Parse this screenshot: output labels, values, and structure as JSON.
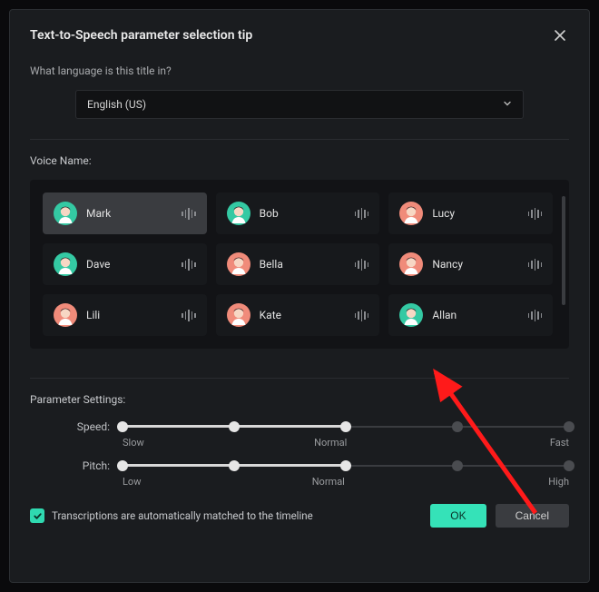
{
  "header": {
    "title": "Text-to-Speech parameter selection tip"
  },
  "language": {
    "prompt": "What language is this title in?",
    "selected": "English (US)"
  },
  "voiceSection": {
    "label": "Voice Name:",
    "voices": [
      {
        "name": "Mark",
        "gender": "m",
        "selected": true
      },
      {
        "name": "Bob",
        "gender": "m",
        "selected": false
      },
      {
        "name": "Lucy",
        "gender": "f",
        "selected": false
      },
      {
        "name": "Dave",
        "gender": "m",
        "selected": false
      },
      {
        "name": "Bella",
        "gender": "f",
        "selected": false
      },
      {
        "name": "Nancy",
        "gender": "f",
        "selected": false
      },
      {
        "name": "Lili",
        "gender": "f",
        "selected": false
      },
      {
        "name": "Kate",
        "gender": "f",
        "selected": false
      },
      {
        "name": "Allan",
        "gender": "m",
        "selected": false
      }
    ]
  },
  "params": {
    "label": "Parameter Settings:",
    "speed": {
      "name": "Speed:",
      "ticks": {
        "low": "Slow",
        "mid": "Normal",
        "high": "Fast"
      },
      "value": 50
    },
    "pitch": {
      "name": "Pitch:",
      "ticks": {
        "low": "Low",
        "mid": "Normal",
        "high": "High"
      },
      "value": 50
    }
  },
  "footer": {
    "transcription_label": "Transcriptions are automatically matched to the timeline",
    "transcription_checked": true,
    "ok": "OK",
    "cancel": "Cancel"
  },
  "colors": {
    "male": "#34c9a3",
    "female": "#f08b7a",
    "accent": "#35e2b8"
  }
}
